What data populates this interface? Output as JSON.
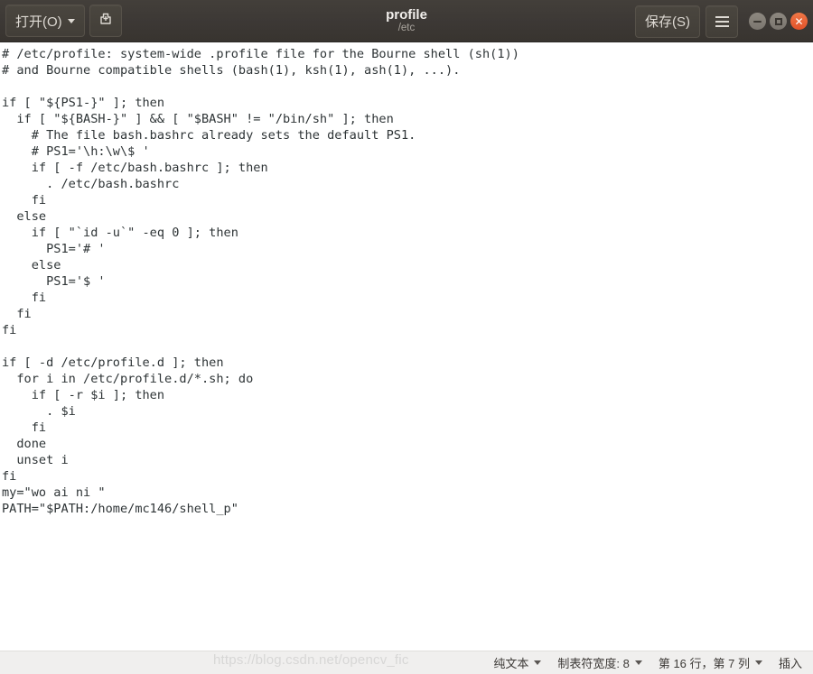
{
  "window": {
    "title": "profile",
    "subtitle": "/etc",
    "open_button": "打开(O)",
    "new_doc_icon": "new-document-icon",
    "save_button": "保存(S)",
    "menu_icon": "hamburger-menu-icon",
    "controls": {
      "minimize": "minimize-icon",
      "maximize": "maximize-icon",
      "close": "✕"
    },
    "colors": {
      "titlebar": "#3c3835",
      "close": "#e2522a",
      "editor_bg": "#ffffff",
      "text": "#2e3436",
      "statusbar_bg": "#f0efee"
    }
  },
  "editor": {
    "content": "# /etc/profile: system-wide .profile file for the Bourne shell (sh(1))\n# and Bourne compatible shells (bash(1), ksh(1), ash(1), ...).\n\nif [ \"${PS1-}\" ]; then\n  if [ \"${BASH-}\" ] && [ \"$BASH\" != \"/bin/sh\" ]; then\n    # The file bash.bashrc already sets the default PS1.\n    # PS1='\\h:\\w\\$ '\n    if [ -f /etc/bash.bashrc ]; then\n      . /etc/bash.bashrc\n    fi\n  else\n    if [ \"`id -u`\" -eq 0 ]; then\n      PS1='# '\n    else\n      PS1='$ '\n    fi\n  fi\nfi\n\nif [ -d /etc/profile.d ]; then\n  for i in /etc/profile.d/*.sh; do\n    if [ -r $i ]; then\n      . $i\n    fi\n  done\n  unset i\nfi\nmy=\"wo ai ni \"\nPATH=\"$PATH:/home/mc146/shell_p\""
  },
  "statusbar": {
    "file_type": "纯文本",
    "tab_width": "制表符宽度: 8",
    "cursor_position": "第 16 行，第 7 列",
    "insert_mode": "插入",
    "watermark": "https://blog.csdn.net/opencv_fic"
  }
}
